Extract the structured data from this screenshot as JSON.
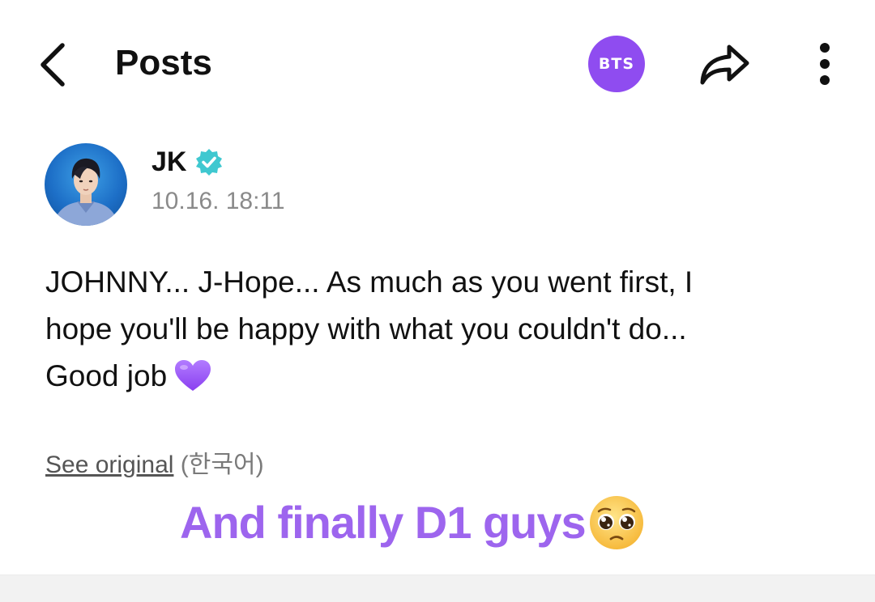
{
  "header": {
    "title": "Posts",
    "artist_badge": "BTS",
    "back_icon": "chevron-left-icon",
    "share_icon": "share-arrow-icon",
    "more_icon": "vertical-dots-icon"
  },
  "post": {
    "author": "JK",
    "verified": true,
    "timestamp": "10.16. 18:11",
    "body_line1": "JOHNNY... J-Hope... As much as you went first, I",
    "body_line2": "hope you'll be happy with what you couldn't do...",
    "body_line3": "Good job",
    "body_emoji": "purple-heart-icon",
    "see_original": "See original",
    "original_language": "(한국어)"
  },
  "overlay_caption": {
    "text": "And finally D1 guys",
    "emoji": "pleading-face-icon"
  },
  "colors": {
    "accent_purple": "#8f4cf0",
    "caption_purple": "#9d65ee",
    "verified_teal": "#3fc8d0",
    "timestamp_gray": "#8a8a8a"
  }
}
